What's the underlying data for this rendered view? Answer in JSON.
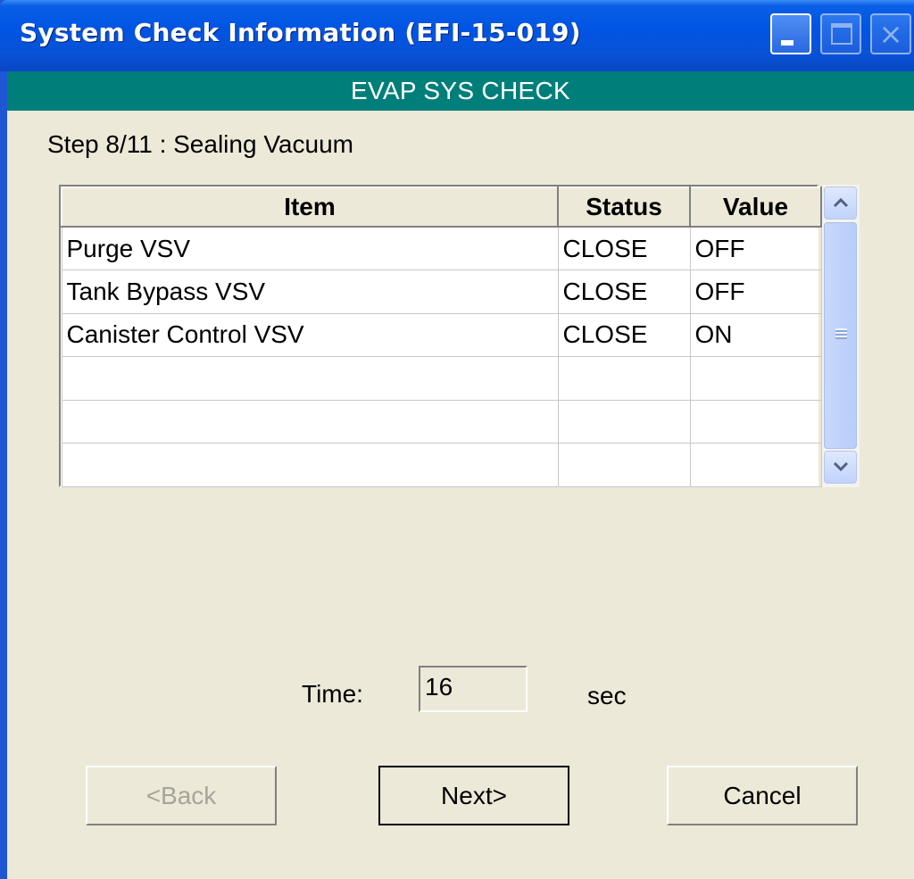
{
  "window": {
    "title": "System Check Information (EFI-15-019)",
    "controls": {
      "minimize": "minimize",
      "maximize": "maximize",
      "close": "×"
    }
  },
  "header": {
    "title": "EVAP SYS CHECK"
  },
  "step": {
    "label": "Step  8/11 : Sealing Vacuum"
  },
  "table": {
    "columns": [
      "Item",
      "Status",
      "Value"
    ],
    "rows": [
      [
        "Purge VSV",
        "CLOSE",
        "OFF"
      ],
      [
        "Tank Bypass VSV",
        "CLOSE",
        "OFF"
      ],
      [
        "Canister Control VSV",
        "CLOSE",
        "ON"
      ],
      [
        "",
        "",
        ""
      ],
      [
        "",
        "",
        ""
      ],
      [
        "",
        "",
        ""
      ]
    ]
  },
  "timer": {
    "label": "Time:",
    "value": "16",
    "unit": "sec"
  },
  "buttons": {
    "back": "<Back",
    "next": "Next>",
    "cancel": "Cancel"
  },
  "colors": {
    "titlebar": "#0054e3",
    "header": "#007f7a",
    "background": "#ece9d8"
  }
}
